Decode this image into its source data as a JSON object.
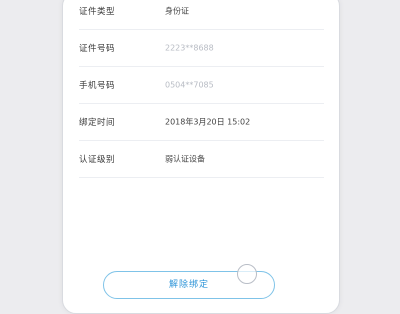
{
  "details": {
    "rows": [
      {
        "label": "证件类型",
        "value": "身份证"
      },
      {
        "label": "证件号码",
        "value": "2223**8688"
      },
      {
        "label": "手机号码",
        "value": "0504**7085"
      },
      {
        "label": "绑定时间",
        "value": "2018年3月20日  15:02"
      },
      {
        "label": "认证级别",
        "value": "弱认证设备"
      }
    ]
  },
  "actions": {
    "unbind_label": "解除绑定"
  }
}
